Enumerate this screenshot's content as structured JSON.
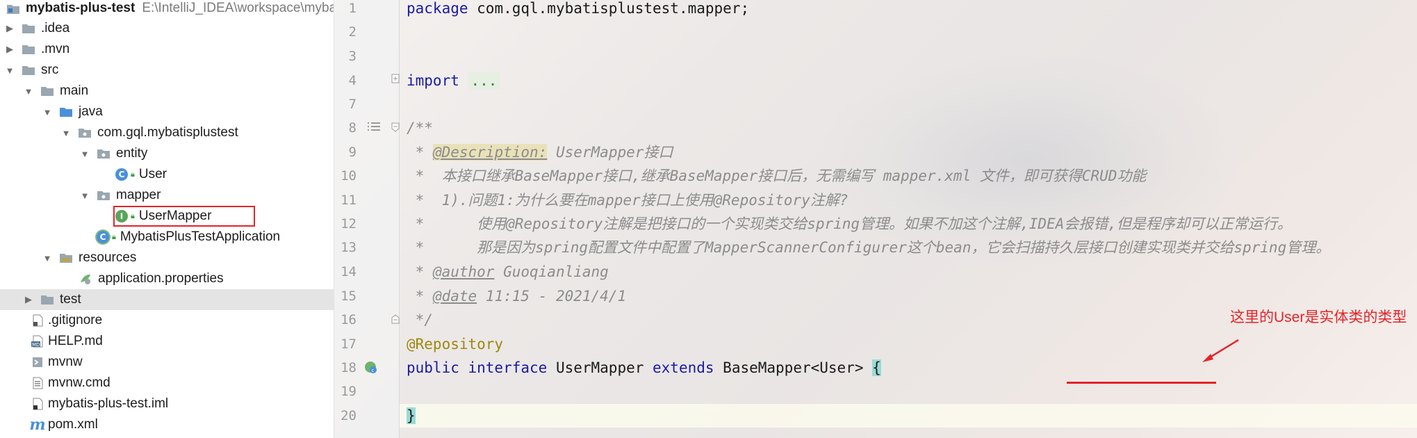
{
  "project_tree": {
    "root": {
      "label": "mybatis-plus-test",
      "path": "E:\\IntelliJ_IDEA\\workspace\\myba"
    },
    "items": [
      {
        "label": ".idea"
      },
      {
        "label": ".mvn"
      },
      {
        "label": "src"
      },
      {
        "label": "main"
      },
      {
        "label": "java"
      },
      {
        "label": "com.gql.mybatisplustest"
      },
      {
        "label": "entity"
      },
      {
        "label": "User"
      },
      {
        "label": "mapper"
      },
      {
        "label": "UserMapper"
      },
      {
        "label": "MybatisPlusTestApplication"
      },
      {
        "label": "resources"
      },
      {
        "label": "application.properties"
      },
      {
        "label": "test"
      },
      {
        "label": ".gitignore"
      },
      {
        "label": "HELP.md"
      },
      {
        "label": "mvnw"
      },
      {
        "label": "mvnw.cmd"
      },
      {
        "label": "mybatis-plus-test.iml"
      },
      {
        "label": "pom.xml"
      }
    ]
  },
  "editor": {
    "line_numbers": [
      "1",
      "2",
      "3",
      "4",
      "7",
      "8",
      "9",
      "10",
      "11",
      "12",
      "13",
      "14",
      "15",
      "16",
      "17",
      "18",
      "19",
      "20"
    ],
    "lines": {
      "l1_kw": "package",
      "l1_rest": " com.gql.mybatisplustest.mapper;",
      "l4_kw": "import",
      "l4_fold": "...",
      "l8": "/**",
      "l9_star": " * ",
      "l9_tag": "@Description:",
      "l9_text": " UserMapper接口",
      "l10": " *  本接口继承BaseMapper接口,继承BaseMapper接口后，无需编写 mapper.xml 文件，即可获得CRUD功能",
      "l11": " *  1).问题1:为什么要在mapper接口上使用@Repository注解?",
      "l12": " *      使用@Repository注解是把接口的一个实现类交给spring管理。如果不加这个注解,IDEA会报错,但是程序却可以正常运行。",
      "l13": " *      那是因为spring配置文件中配置了MapperScannerConfigurer这个bean，它会扫描持久层接口创建实现类并交给spring管理。",
      "l14_star": " * ",
      "l14_tag": "@author",
      "l14_text": " Guoqianliang",
      "l15_star": " * ",
      "l15_tag": "@date",
      "l15_text": " 11:15 - 2021/4/1",
      "l16": " */",
      "l17": "@Repository",
      "l18_kw1": "public interface",
      "l18_name": " UserMapper ",
      "l18_kw2": "extends",
      "l18_type": " BaseMapper<User> ",
      "l18_brace": "{",
      "l20_brace": "}"
    }
  },
  "annotation": {
    "callout_text": "这里的User是实体类的类型",
    "color": "#e3242b"
  },
  "colors": {
    "keyword": "#1a1aa6",
    "annotation": "#9e880d",
    "comment": "#8c8c8c"
  }
}
